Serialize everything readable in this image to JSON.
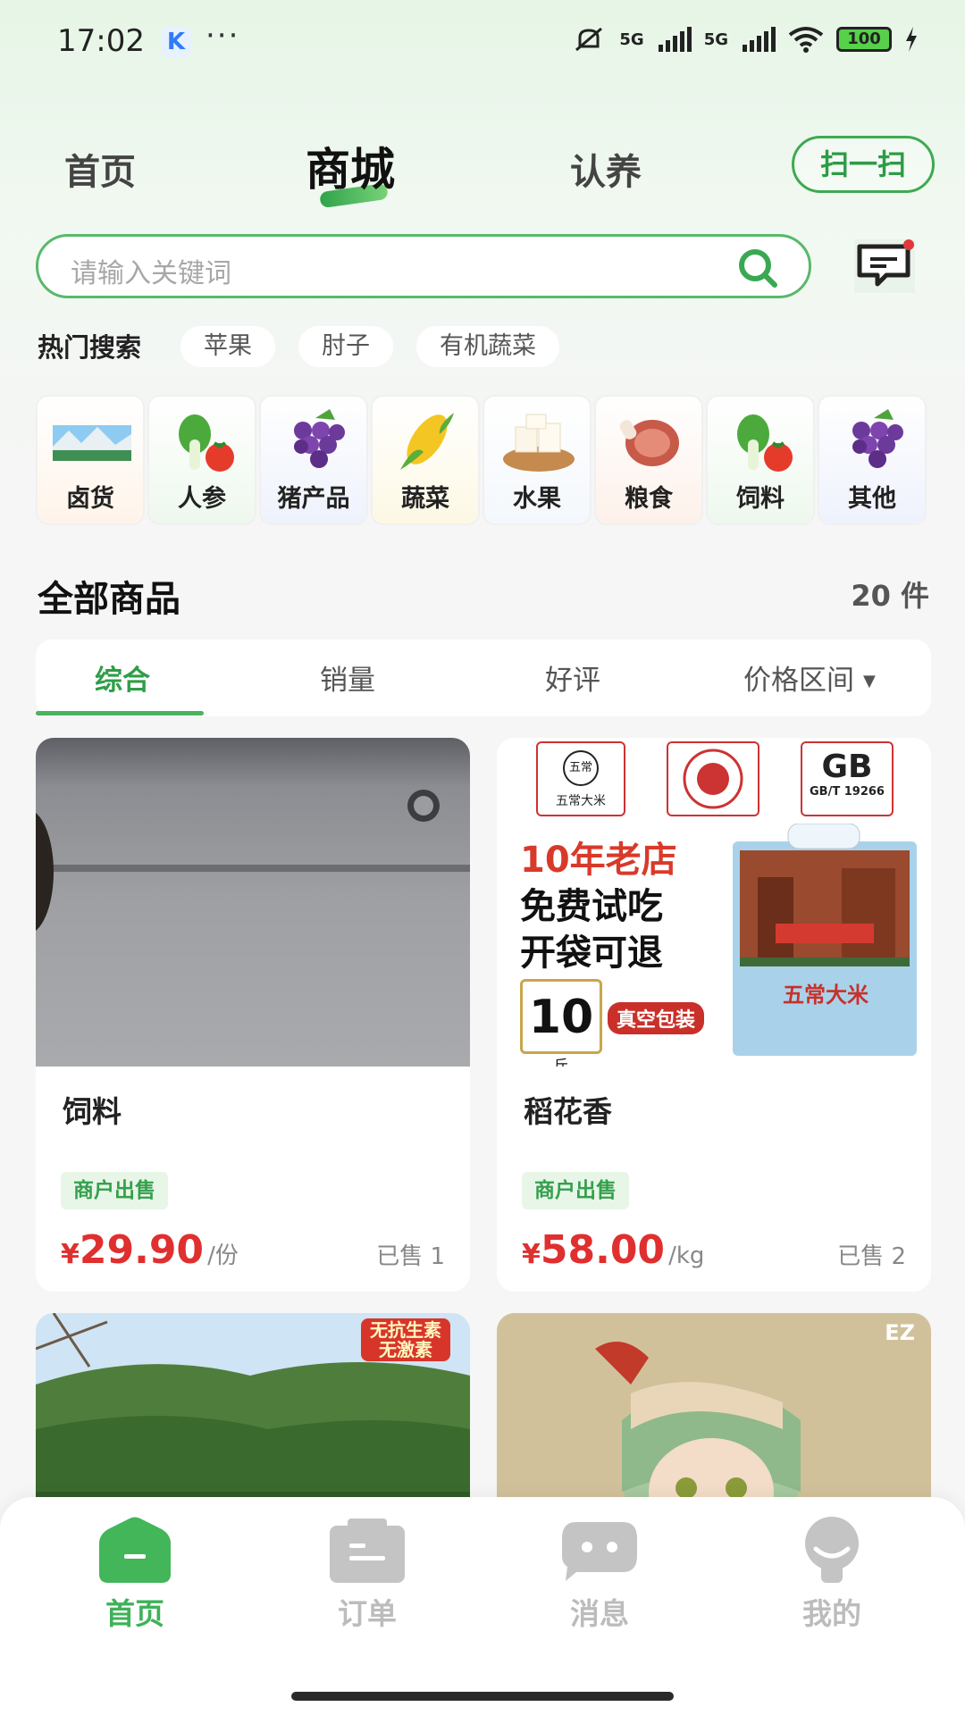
{
  "status_bar": {
    "time": "17:02",
    "app_badge": "K",
    "dots": "···",
    "net1": "5G",
    "net2": "5G",
    "battery": "100"
  },
  "top_nav": {
    "tabs": [
      {
        "label": "首页",
        "active": false
      },
      {
        "label": "商城",
        "active": true
      },
      {
        "label": "认养",
        "active": false
      }
    ],
    "scan_label": "扫一扫"
  },
  "search": {
    "placeholder": "请输入关键词"
  },
  "hot_search": {
    "label": "热门搜索",
    "chips": [
      "苹果",
      "肘子",
      "有机蔬菜"
    ]
  },
  "categories": [
    {
      "label": "卤货",
      "icon": "landscape-icon"
    },
    {
      "label": "人参",
      "icon": "vegetable-icon"
    },
    {
      "label": "猪产品",
      "icon": "grape-icon"
    },
    {
      "label": "蔬菜",
      "icon": "corn-icon"
    },
    {
      "label": "水果",
      "icon": "tofu-icon"
    },
    {
      "label": "粮食",
      "icon": "ham-icon"
    },
    {
      "label": "饲料",
      "icon": "vegetable-icon"
    },
    {
      "label": "其他",
      "icon": "grape-icon"
    }
  ],
  "section": {
    "title": "全部商品",
    "count": "20 件"
  },
  "sort_tabs": [
    {
      "label": "综合",
      "active": true
    },
    {
      "label": "销量",
      "active": false
    },
    {
      "label": "好评",
      "active": false
    },
    {
      "label": "价格区间",
      "active": false
    }
  ],
  "products": [
    {
      "name": "饲料",
      "badge": "商户出售",
      "currency": "¥",
      "price": "29.90",
      "unit": "/份",
      "sold": "已售 1"
    },
    {
      "name": "稻花香",
      "badge": "商户出售",
      "currency": "¥",
      "price": "58.00",
      "unit": "/kg",
      "sold": "已售 2",
      "promo": {
        "line1": "10年老店",
        "line2": "免费试吃",
        "line3": "开袋可退",
        "weight": "10",
        "weight_unit": "斤",
        "vacuum": "真空包装",
        "brand": "五常大米",
        "gb": "GB",
        "gb_code": "GB/T 19266",
        "logo_text": "五常"
      }
    },
    {
      "name": "",
      "promo_tag1": "无抗生素",
      "promo_tag2": "无激素"
    },
    {
      "name": "",
      "corner_text": "EZ"
    }
  ],
  "bottom_nav": [
    {
      "label": "首页",
      "active": true,
      "icon": "home-icon"
    },
    {
      "label": "订单",
      "active": false,
      "icon": "order-icon"
    },
    {
      "label": "消息",
      "active": false,
      "icon": "message-icon"
    },
    {
      "label": "我的",
      "active": false,
      "icon": "profile-icon"
    }
  ],
  "colors": {
    "accent": "#3fb159",
    "price": "#e02f2f"
  }
}
